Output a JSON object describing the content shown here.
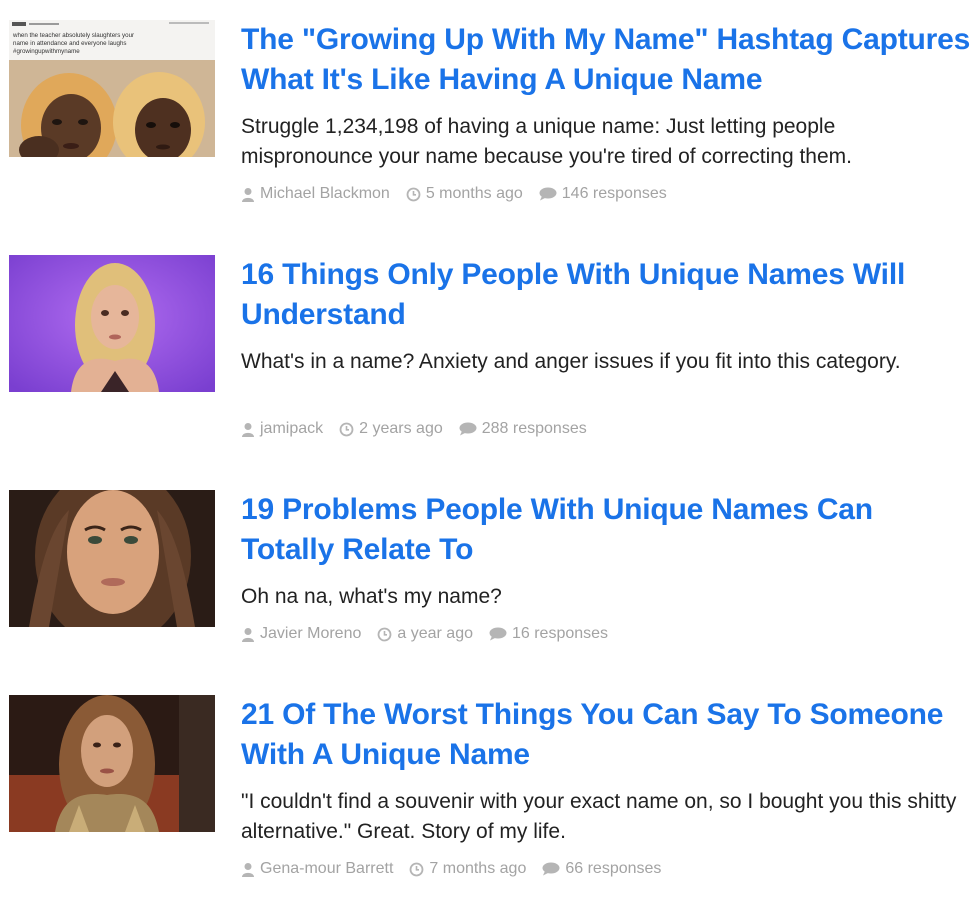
{
  "colors": {
    "title_link": "#1a73e8",
    "description_text": "#222222",
    "meta_text": "#a3a3a3"
  },
  "articles": [
    {
      "title": "The \"Growing Up With My Name\" Hashtag Captures What It's Like Having A Unique Name",
      "description": "Struggle 1,234,198 of having a unique name: Just letting people mispronounce your name because you're tired of correcting them.",
      "author": "Michael Blackmon",
      "time": "5 months ago",
      "responses": "146 responses",
      "thumbnail": {
        "tweet_text": "when the teacher absolutely slaughters your name in attendance and everyone laughs #growingupwithmyname"
      }
    },
    {
      "title": "16 Things Only People With Unique Names Will Understand",
      "description": "What's in a name? Anxiety and anger issues if you fit into this category.",
      "author": "jamipack",
      "time": "2 years ago",
      "responses": "288 responses"
    },
    {
      "title": "19 Problems People With Unique Names Can Totally Relate To",
      "description": "Oh na na, what's my name?",
      "author": "Javier Moreno",
      "time": "a year ago",
      "responses": "16 responses"
    },
    {
      "title": "21 Of The Worst Things You Can Say To Someone With A Unique Name",
      "description": "\"I couldn't find a souvenir with your exact name on, so I bought you this shitty alternative.\" Great. Story of my life.",
      "author": "Gena-mour Barrett",
      "time": "7 months ago",
      "responses": "66 responses"
    }
  ],
  "icons": {
    "author": "user-icon",
    "time": "clock-icon",
    "responses": "speech-bubble-icon"
  }
}
